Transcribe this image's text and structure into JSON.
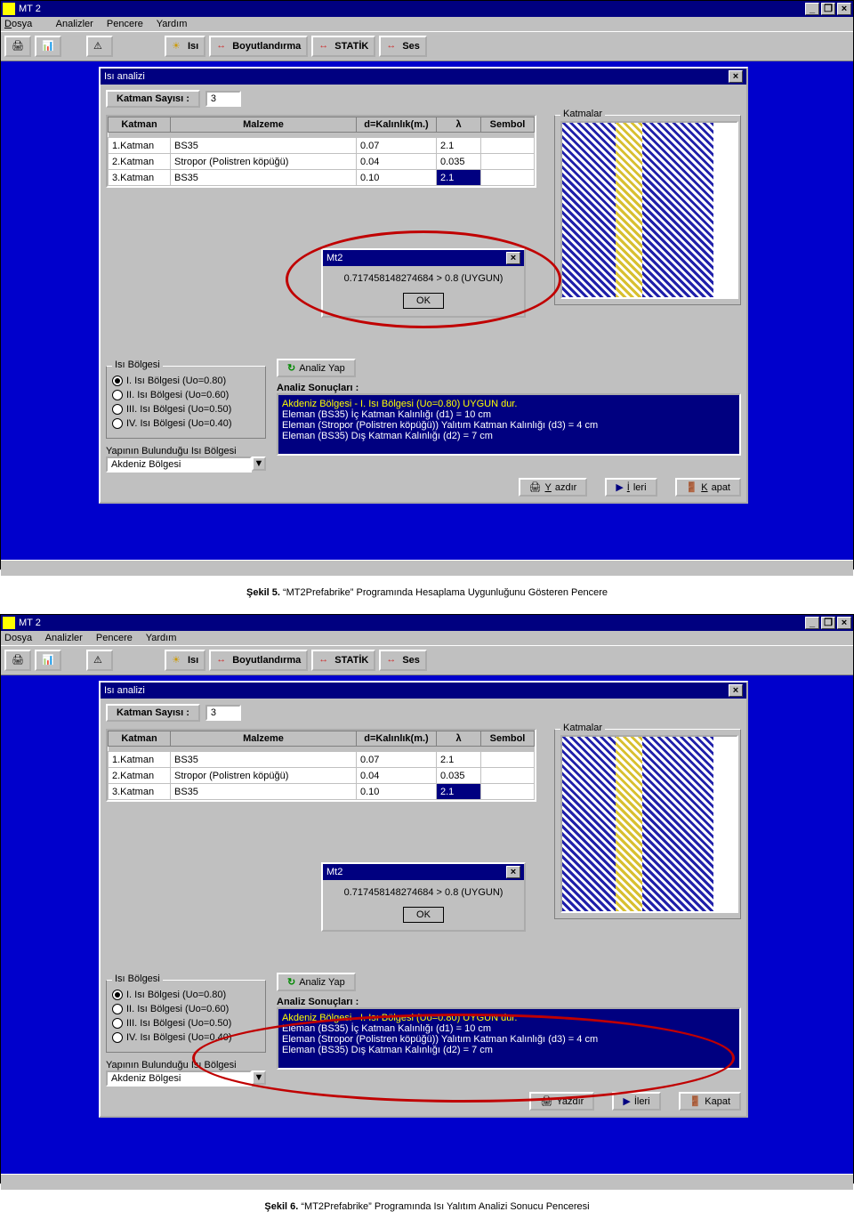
{
  "app": {
    "title": "MT 2",
    "menu": {
      "dosya": "Dosya",
      "analizler": "Analizler",
      "pencere": "Pencere",
      "yardim": "Yardım"
    },
    "toolbar": {
      "isi": "Isı",
      "boyut": "Boyutlandırma",
      "statik": "STATİK",
      "ses": "Ses"
    }
  },
  "analysis": {
    "title": "Isı analizi",
    "katman_sayisi_label": "Katman Sayısı :",
    "katman_sayisi": "3",
    "headers": {
      "katman": "Katman",
      "malzeme": "Malzeme",
      "d": "d=Kalınlık(m.)",
      "lambda": "λ",
      "sembol": "Sembol"
    },
    "rows": [
      {
        "k": "1.Katman",
        "m": "BS35",
        "d": "0.07",
        "l": "2.1"
      },
      {
        "k": "2.Katman",
        "m": "Stropor (Polistren köpüğü)",
        "d": "0.04",
        "l": "0.035"
      },
      {
        "k": "3.Katman",
        "m": "BS35",
        "d": "0.10",
        "l": "2.1"
      }
    ],
    "katmalar_label": "Katmalar",
    "region_group": "Isı Bölgesi",
    "regions": [
      "I.   Isı Bölgesi (Uo=0.80)",
      "II.  Isı Bölgesi (Uo=0.60)",
      "III. Isı Bölgesi (Uo=0.50)",
      "IV. Isı Bölgesi (Uo=0.40)"
    ],
    "yapinin_label": "Yapının Bulunduğu Isı Bölgesi",
    "yapinin_value": "Akdeniz Bölgesi",
    "analiz_yap": "Analiz Yap",
    "sonuc_label": "Analiz Sonuçları :",
    "results": {
      "l1": "Akdeniz Bölgesi - I.   Isı Bölgesi (Uo=0.80) UYGUN dur.",
      "l2": "Eleman (BS35) İç Katman Kalınlığı (d1) = 10 cm",
      "l3": "Eleman (Stropor (Polistren köpüğü)) Yalıtım Katman Kalınlığı (d3) = 4 cm",
      "l4": "Eleman (BS35) Dış Katman Kalınlığı (d2) = 7 cm"
    },
    "yazdir": "Yazdır",
    "ileri": "İleri",
    "kapat": "Kapat"
  },
  "popup": {
    "title": "Mt2",
    "msg": "0.717458148274684 > 0.8 (UYGUN)",
    "ok": "OK"
  },
  "captions": {
    "c1a": "Şekil 5. ",
    "c1b": "“MT2Prefabrike” Programında Hesaplama Uygunluğunu Gösteren Pencere",
    "c2a": "Şekil 6. ",
    "c2b": "“MT2Prefabrike” Programında Isı Yalıtım Analizi Sonucu Penceresi"
  }
}
